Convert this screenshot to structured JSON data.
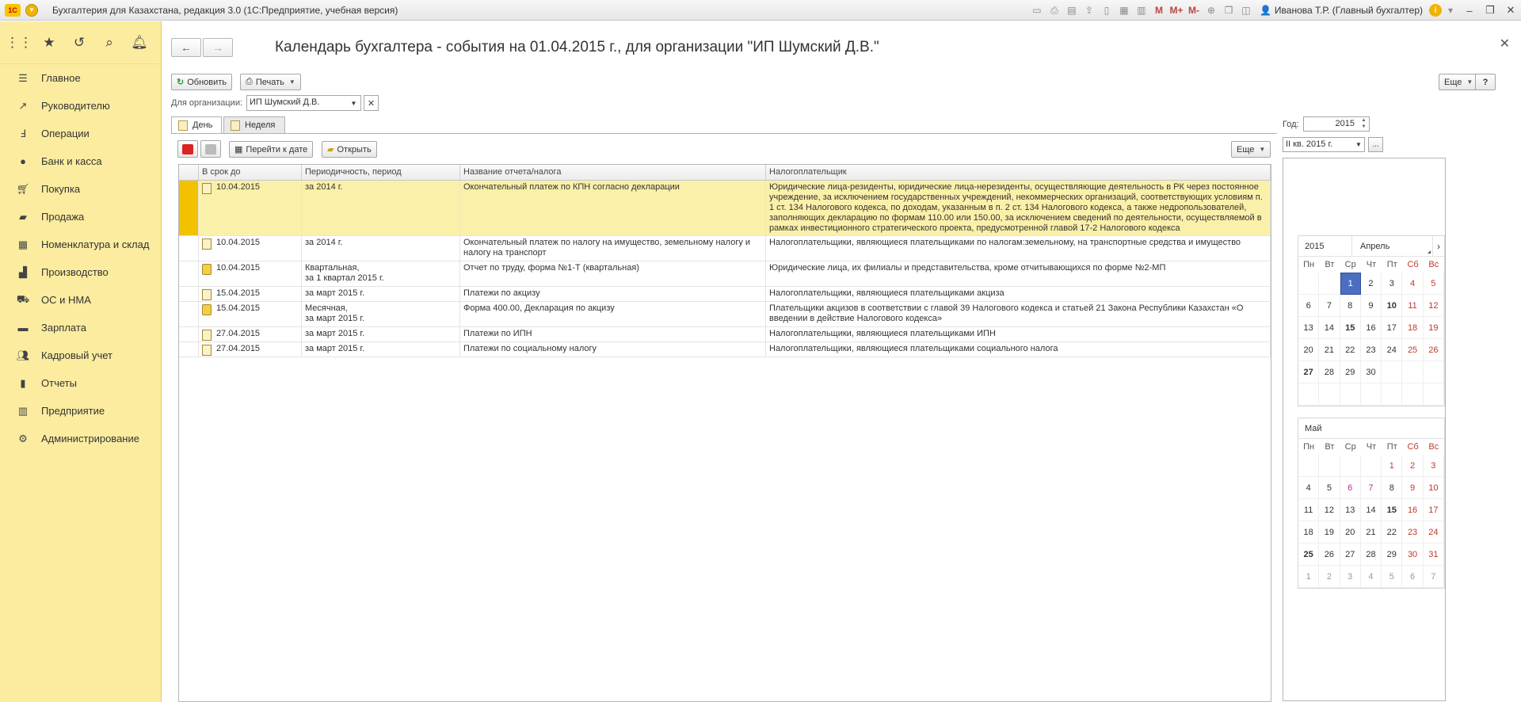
{
  "titlebar": {
    "app_title": "Бухгалтерия для Казахстана, редакция 3.0  (1С:Предприятие, учебная версия)",
    "user": "Иванова Т.Р. (Главный бухгалтер)",
    "m_labels": [
      "M",
      "M+",
      "M-"
    ]
  },
  "sidebar": {
    "items": [
      {
        "label": "Главное",
        "icon": "list-icon"
      },
      {
        "label": "Руководителю",
        "icon": "chart-line-icon"
      },
      {
        "label": "Операции",
        "icon": "operations-icon"
      },
      {
        "label": "Банк и касса",
        "icon": "bank-icon"
      },
      {
        "label": "Покупка",
        "icon": "cart-icon"
      },
      {
        "label": "Продажа",
        "icon": "bag-icon"
      },
      {
        "label": "Номенклатура и склад",
        "icon": "grid-icon"
      },
      {
        "label": "Производство",
        "icon": "factory-icon"
      },
      {
        "label": "ОС и НМА",
        "icon": "truck-icon"
      },
      {
        "label": "Зарплата",
        "icon": "wallet-icon"
      },
      {
        "label": "Кадровый учет",
        "icon": "people-icon"
      },
      {
        "label": "Отчеты",
        "icon": "bar-chart-icon"
      },
      {
        "label": "Предприятие",
        "icon": "building-icon"
      },
      {
        "label": "Администрирование",
        "icon": "gear-icon"
      }
    ]
  },
  "page": {
    "title": "Календарь бухгалтера - события на 01.04.2015 г., для организации \"ИП Шумский Д.В.\""
  },
  "toolbar": {
    "refresh": "Обновить",
    "print": "Печать",
    "more": "Еще",
    "help": "?"
  },
  "org": {
    "label": "Для организации:",
    "value": "ИП Шумский Д.В."
  },
  "tabs": [
    {
      "label": "День"
    },
    {
      "label": "Неделя"
    }
  ],
  "grid_toolbar": {
    "goto_date": "Перейти к дате",
    "open": "Открыть",
    "more": "Еще"
  },
  "grid": {
    "columns": [
      "В срок до",
      "Периодичность, период",
      "Название отчета/налога",
      "Налогоплательщик"
    ],
    "rows": [
      {
        "due": "10.04.2015",
        "period": "за 2014 г.",
        "name": "Окончательный платеж по КПН согласно декларации",
        "payer": "Юридические лица-резиденты, юридические лица-нерезиденты, осуществляющие деятельность в РК через постоянное учреждение, за исключением государственных учреждений, некоммерческих организаций, соответствующих условиям п. 1 ст. 134 Налогового кодекса, по доходам, указанным в п. 2 ст. 134 Налогового кодекса, а также недропользователей, заполняющих декларацию по формам 110.00 или 150.00, за исключением сведений по деятельности, осуществляемой в рамках инвестиционного стратегического проекта, предусмотренной главой 17-2 Налогового кодекса"
      },
      {
        "due": "10.04.2015",
        "period": "за 2014 г.",
        "name": "Окончательный платеж по налогу на имущество, земельному налогу и налогу на транспорт",
        "payer": "Налогоплательщики, являющиеся плательщиками по налогам:земельному, на транспортные средства и имущество"
      },
      {
        "due": "10.04.2015",
        "period": "Квартальная,\nза 1 квартал 2015 г.",
        "name": "Отчет по труду, форма №1-Т (квартальная)",
        "payer": "Юридические лица, их филиалы и представительства, кроме отчитывающихся по форме №2-МП"
      },
      {
        "due": "15.04.2015",
        "period": "за март 2015 г.",
        "name": "Платежи по акцизу",
        "payer": "Налогоплательщики, являющиеся плательщиками акциза"
      },
      {
        "due": "15.04.2015",
        "period": "Месячная,\nза март 2015 г.",
        "name": "Форма 400.00, Декларация по акцизу",
        "payer": "Плательщики акцизов в соответствии с главой 39 Налогового кодекса и статьей 21 Закона Республики Казахстан «О введении в действие Налогового кодекса»"
      },
      {
        "due": "27.04.2015",
        "period": "за март 2015 г.",
        "name": "Платежи по ИПН",
        "payer": "Налогоплательщики, являющиеся плательщиками ИПН"
      },
      {
        "due": "27.04.2015",
        "period": "за март 2015 г.",
        "name": "Платежи по социальному налогу",
        "payer": "Налогоплательщики, являющиеся плательщиками социального налога"
      }
    ]
  },
  "right": {
    "year_label": "Год:",
    "year_value": "2015",
    "quarter_value": "II кв. 2015 г.",
    "more_btn": "..."
  },
  "calendar": {
    "weekdays": [
      "Пн",
      "Вт",
      "Ср",
      "Чт",
      "Пт",
      "Сб",
      "Вс"
    ],
    "april": {
      "year": "2015",
      "month": "Апрель",
      "next": "›",
      "days": [
        "",
        "",
        "1",
        "2",
        "3",
        "4",
        "5",
        "6",
        "7",
        "8",
        "9",
        "10",
        "11",
        "12",
        "13",
        "14",
        "15",
        "16",
        "17",
        "18",
        "19",
        "20",
        "21",
        "22",
        "23",
        "24",
        "25",
        "26",
        "27",
        "28",
        "29",
        "30",
        "",
        "",
        "",
        "",
        "",
        "",
        "",
        "",
        "",
        ""
      ]
    },
    "may": {
      "month": "Май",
      "days": [
        "",
        "",
        "",
        "",
        "1",
        "2",
        "3",
        "4",
        "5",
        "6",
        "7",
        "8",
        "9",
        "10",
        "11",
        "12",
        "13",
        "14",
        "15",
        "16",
        "17",
        "18",
        "19",
        "20",
        "21",
        "22",
        "23",
        "24",
        "25",
        "26",
        "27",
        "28",
        "29",
        "30",
        "31",
        "1",
        "2",
        "3",
        "4",
        "5",
        "6",
        "7"
      ]
    }
  }
}
